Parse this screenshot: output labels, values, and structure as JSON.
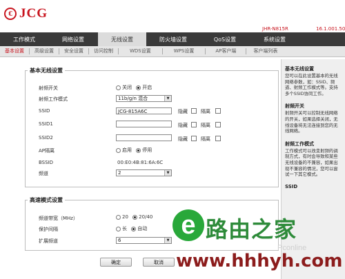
{
  "brand": {
    "mark": "€",
    "name": "JCG",
    "color": "#c8141e"
  },
  "header": {
    "model": "JHR-N815R",
    "version": "16.1.001.505"
  },
  "main_nav": [
    "工作模式",
    "网络设置",
    "无线设置",
    "防火墙设置",
    "QoS设置",
    "系统设置"
  ],
  "sub_nav": [
    "基本设置",
    "高级设置",
    "安全设置",
    "访问控制",
    "WDS设置",
    "WPS设置",
    "AP客户端",
    "客户端列表"
  ],
  "basic": {
    "title": "基本无线设置",
    "radio_switch": {
      "label": "射频开关",
      "off": "关闭",
      "on": "开启"
    },
    "mode": {
      "label": "射频工作模式",
      "value": "11b/g/n 混合"
    },
    "ssid": {
      "label": "SSID",
      "value": "JCG-815A6C"
    },
    "ssid1": {
      "label": "SSID1",
      "value": ""
    },
    "ssid2": {
      "label": "SSID2",
      "value": ""
    },
    "hide": "隐藏",
    "isolate": "隔离",
    "ap_isolate": {
      "label": "AP隔离",
      "enable": "启用",
      "disable": "停用"
    },
    "bssid": {
      "label": "BSSID",
      "value": "00:E0:4B:81:6A:6C"
    },
    "channel": {
      "label": "频道",
      "value": "2"
    }
  },
  "advanced": {
    "title": "高速模式设置",
    "bandwidth": {
      "label": "频道带宽（MHz）",
      "opt1": "20",
      "opt2": "20/40"
    },
    "guard": {
      "label": "保护间隔",
      "opt1": "长",
      "opt2": "自动"
    },
    "ext_channel": {
      "label": "扩展频道",
      "value": "6"
    }
  },
  "buttons": {
    "ok": "确定",
    "cancel": "取消"
  },
  "help": {
    "h1": "基本无线设置",
    "p1": "您可以在此设置基本的无线网络参数，如：SSID、频道、射频工作模式等。支持多个SSID协同工作。",
    "h2": "射频开关",
    "p2": "射频开关可以控制无线网络的开关，如果选择关闭，无线设备将无法连接到您的无线网络。",
    "h3": "射频工作模式",
    "p3": "工作模式可以改变射频的调制方式，有时会导致和某些无线设备的不兼容，如果出现不兼容的情况，您可以尝试一下其它模式。",
    "h4": "SSID"
  },
  "watermark": {
    "text": "路由之家",
    "url": "www.hhhyh.com",
    "faint": "Pconline"
  }
}
